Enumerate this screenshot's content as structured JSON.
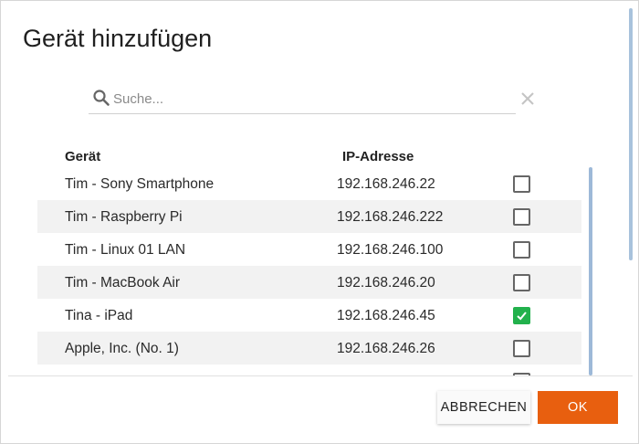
{
  "dialog": {
    "title": "Gerät hinzufügen"
  },
  "search": {
    "placeholder": "Suche...",
    "icon": "search-icon",
    "clear_icon": "close-icon"
  },
  "table": {
    "headers": {
      "device": "Gerät",
      "ip": "IP-Adresse"
    },
    "rows": [
      {
        "name": "Tim - Sony Smartphone",
        "ip": "192.168.246.22",
        "checked": false
      },
      {
        "name": "Tim - Raspberry Pi",
        "ip": "192.168.246.222",
        "checked": false
      },
      {
        "name": "Tim - Linux 01 LAN",
        "ip": "192.168.246.100",
        "checked": false
      },
      {
        "name": "Tim - MacBook Air",
        "ip": "192.168.246.20",
        "checked": false
      },
      {
        "name": "Tina - iPad",
        "ip": "192.168.246.45",
        "checked": true
      },
      {
        "name": "Apple, Inc. (No. 1)",
        "ip": "192.168.246.26",
        "checked": false
      }
    ]
  },
  "footer": {
    "cancel_label": "ABBRECHEN",
    "ok_label": "OK"
  },
  "colors": {
    "accent": "#e85f0f",
    "checked": "#22b14c",
    "scrollbar": "#9db9d8"
  }
}
